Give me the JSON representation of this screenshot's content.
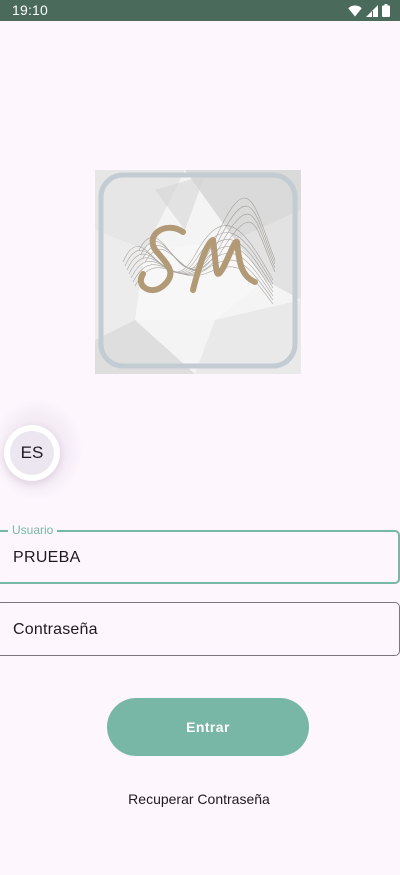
{
  "status_bar": {
    "time": "19:10",
    "background": "#4a6b5c",
    "icons": [
      "wifi-icon",
      "signal-icon",
      "battery-icon"
    ]
  },
  "logo": {
    "initials": "SM",
    "icon": "brand-logo"
  },
  "language": {
    "code": "ES"
  },
  "form": {
    "username": {
      "label": "Usuario",
      "value": "PRUEBA"
    },
    "password": {
      "placeholder": "Contraseña"
    },
    "submit_label": "Entrar",
    "recover_label": "Recuperar Contraseña"
  },
  "colors": {
    "accent": "#78b6a5",
    "background": "#fdf6fd",
    "status_bar": "#4a6b5c"
  }
}
